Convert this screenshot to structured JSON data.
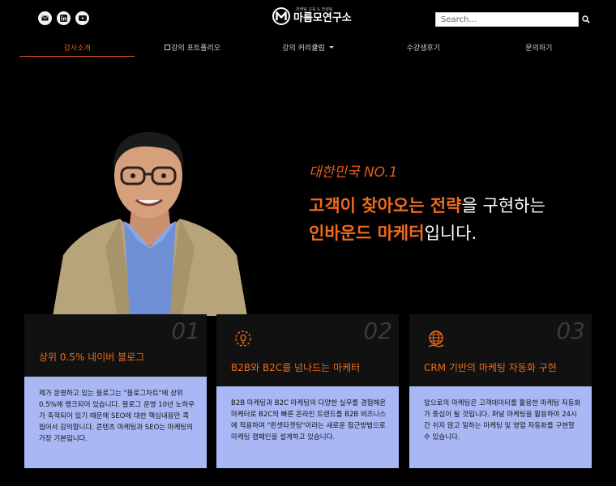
{
  "header": {
    "logo_sub": "마케팅 교육 & 컨설팅",
    "logo_name": "마름모연구소",
    "search_placeholder": "Search...",
    "social": [
      "mail-icon",
      "linkedin-icon",
      "youtube-icon"
    ]
  },
  "nav": {
    "items": [
      {
        "label": "강사소개",
        "active": true
      },
      {
        "label": "강의 포트폴리오",
        "active": false
      },
      {
        "label": "강의 커리큘럼",
        "active": false,
        "dropdown": true
      },
      {
        "label": "수강생후기",
        "active": false
      },
      {
        "label": "문의하기",
        "active": false
      }
    ]
  },
  "hero": {
    "tag": "대한민국 NO.1",
    "line1_hl": "고객이 찾아오는 전략",
    "line1_rest": "을 구현하는",
    "line2_hl": "인바운드 마케터",
    "line2_rest": "입니다."
  },
  "cards": [
    {
      "num": "01",
      "title": "상위 0.5% 네이버 블로그",
      "body": "제가 운영하고 있는 블로그는 \"블로그차트\"에 상위 0.5%에 랭크되어 있습니다. 블로그 운영 10년 노하우가 축적되어 있기 때문에 SEO에 대한 핵심내용만 콕 찝어서 강의합니다. 콘텐츠 마케팅과 SEO는 마케팅의 가장 기본입니다."
    },
    {
      "num": "02",
      "title": "B2B와 B2C를 넘나드는 마케터",
      "icon": "gear-bulb-icon",
      "body": "B2B 마케팅과 B2C 마케팅의 다양한 실무를 경험해온 마케터로 B2C의 빠른 온라인 트렌드를 B2B 비즈니스에 적용하여 \"핀셋타겟팅\"이라는 새로운 접근방법으로 마케팅 캠페인을 설계하고 있습니다."
    },
    {
      "num": "03",
      "title": "CRM 기반의 마케팅 자동화 구현",
      "icon": "globe-hand-icon",
      "body": "앞으로의 마케팅은 고객데이터를 활용한 마케팅 자동화가 중심이 될 것입니다. 퍼널 마케팅을 활용하여 24시간 쉬지 않고 일하는 마케팅 및 영업 자동화를 구현할 수 있습니다."
    }
  ],
  "colors": {
    "accent": "#e05a1b",
    "card_body": "#a9b8f4",
    "card_top": "#111111"
  }
}
